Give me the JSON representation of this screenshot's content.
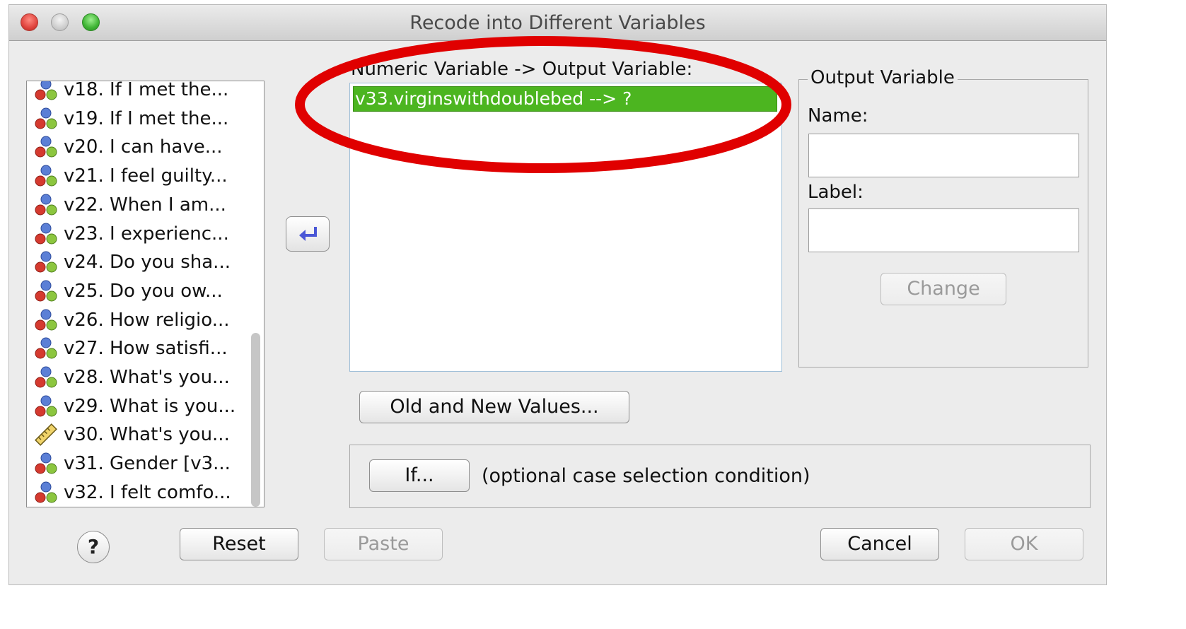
{
  "window": {
    "title": "Recode into Different Variables"
  },
  "variables": [
    {
      "label": "v18. If I met the...",
      "type": "nominal"
    },
    {
      "label": "v19. If I met the...",
      "type": "nominal"
    },
    {
      "label": "v20. I can have...",
      "type": "nominal"
    },
    {
      "label": "v21. I feel guilty...",
      "type": "nominal"
    },
    {
      "label": "v22. When I am...",
      "type": "nominal"
    },
    {
      "label": "v23. I experienc...",
      "type": "nominal"
    },
    {
      "label": "v24. Do you sha...",
      "type": "nominal"
    },
    {
      "label": "v25. Do you ow...",
      "type": "nominal"
    },
    {
      "label": "v26. How religio...",
      "type": "nominal"
    },
    {
      "label": "v27. How satisfi...",
      "type": "nominal"
    },
    {
      "label": "v28. What's you...",
      "type": "nominal"
    },
    {
      "label": "v29. What is you...",
      "type": "nominal"
    },
    {
      "label": "v30. What's you...",
      "type": "scale"
    },
    {
      "label": "v31. Gender [v3...",
      "type": "nominal"
    },
    {
      "label": "v32. I felt comfo...",
      "type": "nominal"
    }
  ],
  "move_button": {
    "icon": "arrow-left-icon"
  },
  "mapping": {
    "label": "Numeric Variable -> Output Variable:",
    "items": [
      "v33.virginswithdoublebed --> ?"
    ]
  },
  "output_variable": {
    "group_title": "Output Variable",
    "name_label": "Name:",
    "name_value": "",
    "label_label": "Label:",
    "label_value": "",
    "change_button": "Change"
  },
  "old_new_button": "Old and New Values...",
  "if_section": {
    "button": "If...",
    "description": "(optional case selection condition)"
  },
  "footer": {
    "help": "?",
    "reset": "Reset",
    "paste": "Paste",
    "cancel": "Cancel",
    "ok": "OK"
  },
  "colors": {
    "selection": "#4cb520",
    "annotation": "#e00000",
    "arrow": "#4a57d6"
  }
}
